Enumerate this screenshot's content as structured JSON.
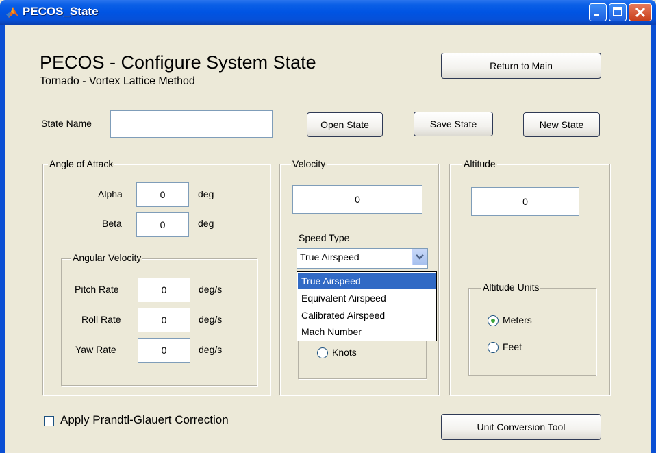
{
  "window": {
    "title": "PECOS_State"
  },
  "header": {
    "title": "PECOS - Configure System State",
    "subtitle": "Tornado - Vortex Lattice Method",
    "return_button": "Return to Main"
  },
  "state": {
    "name_label": "State Name",
    "name_value": "",
    "open_button": "Open State",
    "save_button": "Save State",
    "new_button": "New State"
  },
  "angle_of_attack": {
    "group_title": "Angle of Attack",
    "alpha_label": "Alpha",
    "alpha_value": "0",
    "alpha_unit": "deg",
    "beta_label": "Beta",
    "beta_value": "0",
    "beta_unit": "deg",
    "angular_velocity": {
      "group_title": "Angular Velocity",
      "pitch_label": "Pitch Rate",
      "pitch_value": "0",
      "pitch_unit": "deg/s",
      "roll_label": "Roll Rate",
      "roll_value": "0",
      "roll_unit": "deg/s",
      "yaw_label": "Yaw Rate",
      "yaw_value": "0",
      "yaw_unit": "deg/s"
    }
  },
  "velocity": {
    "group_title": "Velocity",
    "value": "0",
    "speed_type_label": "Speed Type",
    "speed_type_selected": "True Airspeed",
    "speed_type_options": [
      "True Airspeed",
      "Equivalent Airspeed",
      "Calibrated Airspeed",
      "Mach Number"
    ],
    "knots_label": "Knots"
  },
  "altitude": {
    "group_title": "Altitude",
    "value": "0",
    "units_group_title": "Altitude Units",
    "meters_label": "Meters",
    "feet_label": "Feet",
    "selected_unit": "Meters"
  },
  "footer": {
    "prandtl_label": "Apply Prandtl-Glauert Correction",
    "prandtl_checked": false,
    "unit_conversion_button": "Unit Conversion Tool"
  },
  "colors": {
    "titlebar": "#0054e3",
    "face": "#ece9d8",
    "selection": "#316ac5",
    "radio_dot": "#3aa43a"
  }
}
